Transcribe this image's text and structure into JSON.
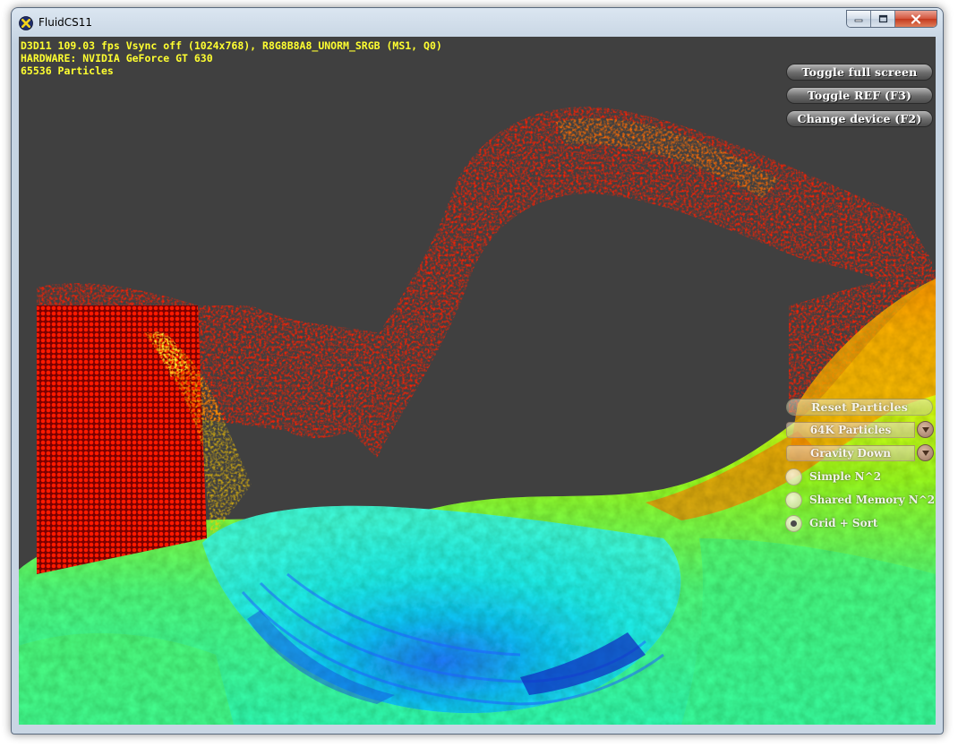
{
  "window": {
    "title": "FluidCS11",
    "icons": {
      "app": "dx-sdk-app-icon",
      "minimize": "minimize-icon",
      "maximize": "maximize-icon",
      "close": "close-icon"
    }
  },
  "hud": {
    "line1": "D3D11 109.03 fps Vsync off (1024x768), R8G8B8A8_UNORM_SRGB (MS1, Q0)",
    "line2": "HARDWARE: NVIDIA GeForce GT 630",
    "line3": "65536 Particles",
    "color": "#ffff30"
  },
  "top_buttons": [
    {
      "label": "Toggle full screen"
    },
    {
      "label": "Toggle REF (F3)"
    },
    {
      "label": "Change device (F2)"
    }
  ],
  "controls": {
    "reset_label": "Reset Particles",
    "particles_combo": {
      "selected": "64K Particles"
    },
    "gravity_combo": {
      "selected": "Gravity Down"
    },
    "algorithms": [
      {
        "label": "Simple N^2",
        "selected": false
      },
      {
        "label": "Shared Memory N^2",
        "selected": false
      },
      {
        "label": "Grid + Sort",
        "selected": true
      }
    ]
  },
  "simulation": {
    "background": "#404040",
    "colors": {
      "low_density": "#ff0000",
      "mid_density": "#ffff00",
      "high_density": "#00ffff",
      "max_density": "#0000c0"
    }
  }
}
